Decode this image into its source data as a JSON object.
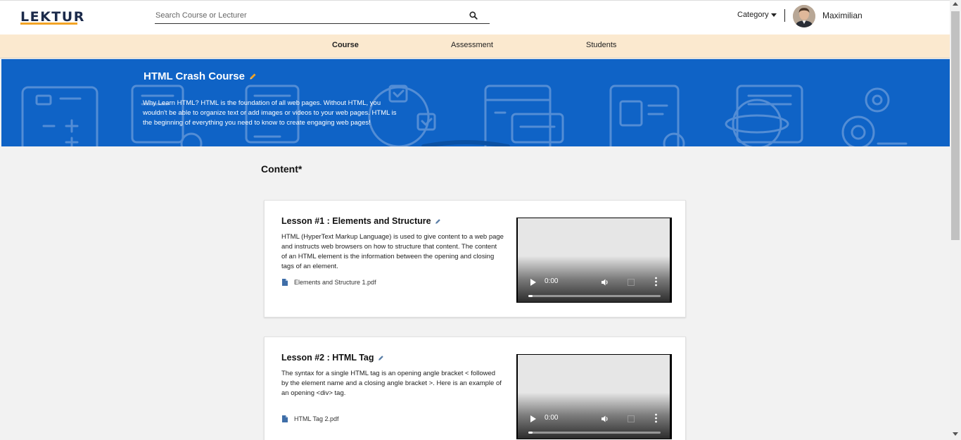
{
  "header": {
    "logo": "LEKTUR",
    "search_placeholder": "Search Course or Lecturer",
    "category_label": "Category",
    "username": "Maximilian"
  },
  "tabs": [
    {
      "label": "Course",
      "active": true
    },
    {
      "label": "Assessment",
      "active": false
    },
    {
      "label": "Students",
      "active": false
    }
  ],
  "hero": {
    "title": "HTML Crash Course",
    "description": "Why Learn HTML? HTML is the foundation of all web pages. Without HTML, you wouldn't be able to organize text or add images or videos to your web pages. HTML is the beginning of everything you need to know to create engaging web pages!"
  },
  "content": {
    "heading": "Content*",
    "lessons": [
      {
        "title": "Lesson #1 : Elements and Structure",
        "description": "HTML (HyperText Markup Language) is used to give content to a web page and instructs web browsers on how to structure that content. The content of an HTML element is the information between the opening and closing tags of an element.",
        "attachment": "Elements and Structure 1.pdf",
        "video_time": "0:00"
      },
      {
        "title": "Lesson #2 : HTML Tag",
        "description": "The syntax for a single HTML tag is an opening angle bracket < followed by the element name and a closing angle bracket >. Here is an example of an opening <div> tag.",
        "attachment": "HTML Tag 2.pdf",
        "video_time": "0:00"
      }
    ]
  },
  "colors": {
    "brand_navy": "#1b2a4a",
    "brand_orange": "#f2a324",
    "hero_blue": "#0f63c6",
    "tab_bar": "#fbe9cf"
  },
  "icons": [
    "search-icon",
    "caret-down-icon",
    "edit-pencil-icon",
    "file-icon",
    "play-icon",
    "volume-icon",
    "fullscreen-icon",
    "more-vert-icon"
  ]
}
